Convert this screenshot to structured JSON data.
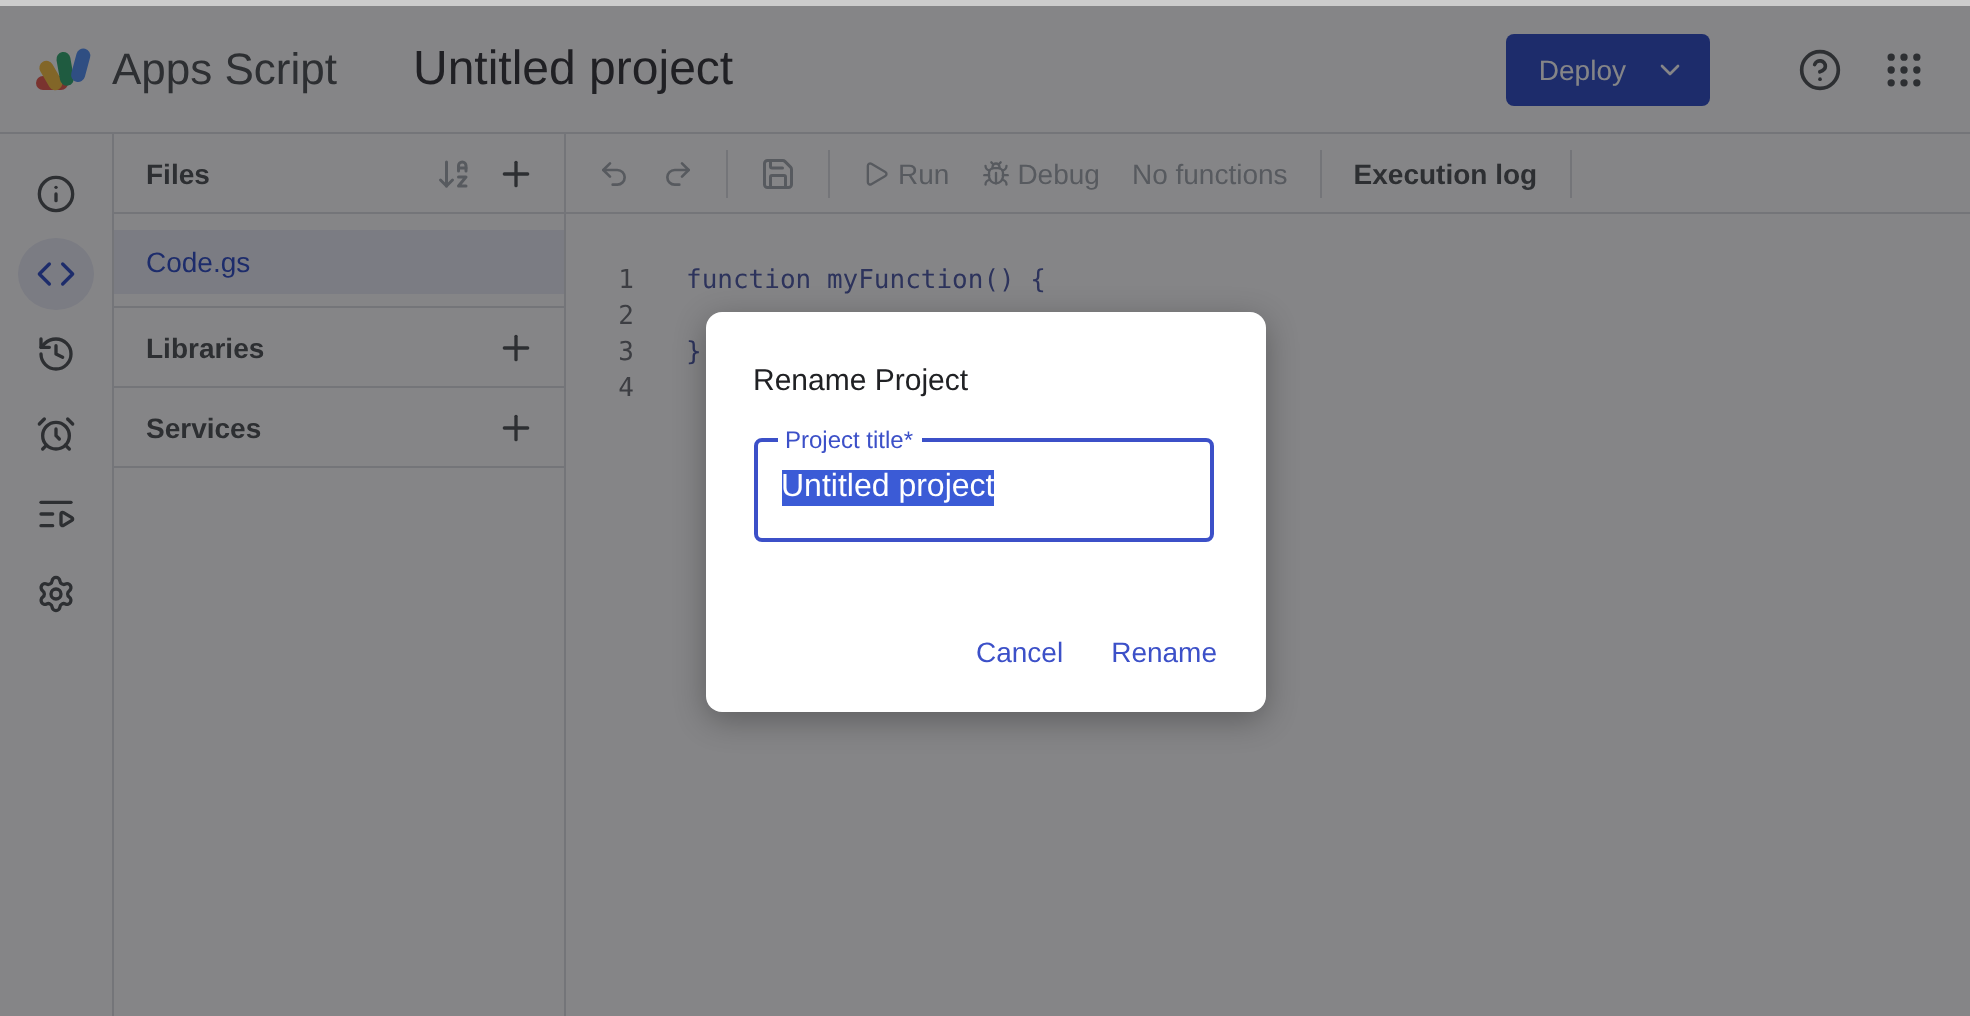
{
  "header": {
    "app_name": "Apps Script",
    "project_title": "Untitled project",
    "deploy_button": "Deploy"
  },
  "rail": [
    {
      "kind": "info",
      "selected": false
    },
    {
      "kind": "code",
      "selected": true
    },
    {
      "kind": "history",
      "selected": false
    },
    {
      "kind": "alarm",
      "selected": false
    },
    {
      "kind": "executions",
      "selected": false
    },
    {
      "kind": "settings",
      "selected": false
    }
  ],
  "files_panel": {
    "title": "Files",
    "files": [
      {
        "name": "Code.gs",
        "selected": true
      }
    ],
    "sections": [
      "Libraries",
      "Services"
    ]
  },
  "toolbar": {
    "run": "Run",
    "debug": "Debug",
    "function_select": "No functions",
    "execution_log": "Execution log"
  },
  "editor": {
    "lines": [
      {
        "number": "1",
        "text": "function myFunction() {"
      },
      {
        "number": "2"
      },
      {
        "number": "3",
        "text": "}"
      },
      {
        "number": "4"
      }
    ]
  },
  "dialog": {
    "title": "Rename Project",
    "field_label": "Project title*",
    "field_value": "Untitled project",
    "buttons": [
      "Cancel",
      "Rename"
    ]
  }
}
